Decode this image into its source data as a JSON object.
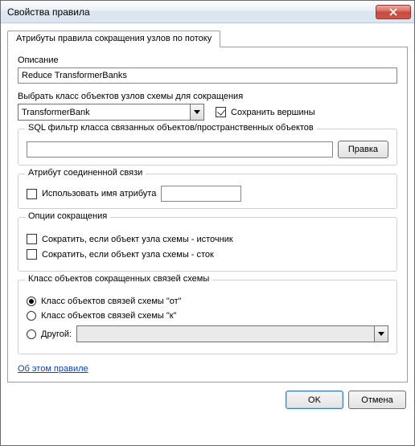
{
  "window": {
    "title": "Свойства правила",
    "close_icon": "close-icon"
  },
  "tab": {
    "label": "Атрибуты правила сокращения узлов по потоку"
  },
  "description": {
    "label": "Описание",
    "value": "Reduce TransformerBanks"
  },
  "select_class": {
    "label": "Выбрать класс объектов узлов схемы для сокращения",
    "value": "TransformerBank"
  },
  "keep_vertices": {
    "label": "Сохранить вершины",
    "checked": true
  },
  "sql_group": {
    "legend": "SQL фильтр класса связанных объектов/пространственных объектов",
    "value": "",
    "edit_label": "Правка"
  },
  "attribute_group": {
    "legend": "Атрибут соединенной связи",
    "use_attr_name_label": "Использовать имя атрибута",
    "use_attr_name_checked": false,
    "attr_value": ""
  },
  "reduce_options": {
    "legend": "Опции сокращения",
    "if_source_label": "Сократить, если объект узла схемы - источник",
    "if_source_checked": false,
    "if_sink_label": "Сократить, если объект узла схемы - сток",
    "if_sink_checked": false
  },
  "reduced_class": {
    "legend": "Класс объектов сокращенных связей схемы",
    "opt_from_label": "Класс объектов связей схемы \"от\"",
    "opt_to_label": "Класс объектов связей схемы \"к\"",
    "opt_other_label": "Другой:",
    "selected": "from",
    "other_value": ""
  },
  "about_link": "Об этом правиле",
  "footer": {
    "ok": "OK",
    "cancel": "Отмена"
  }
}
